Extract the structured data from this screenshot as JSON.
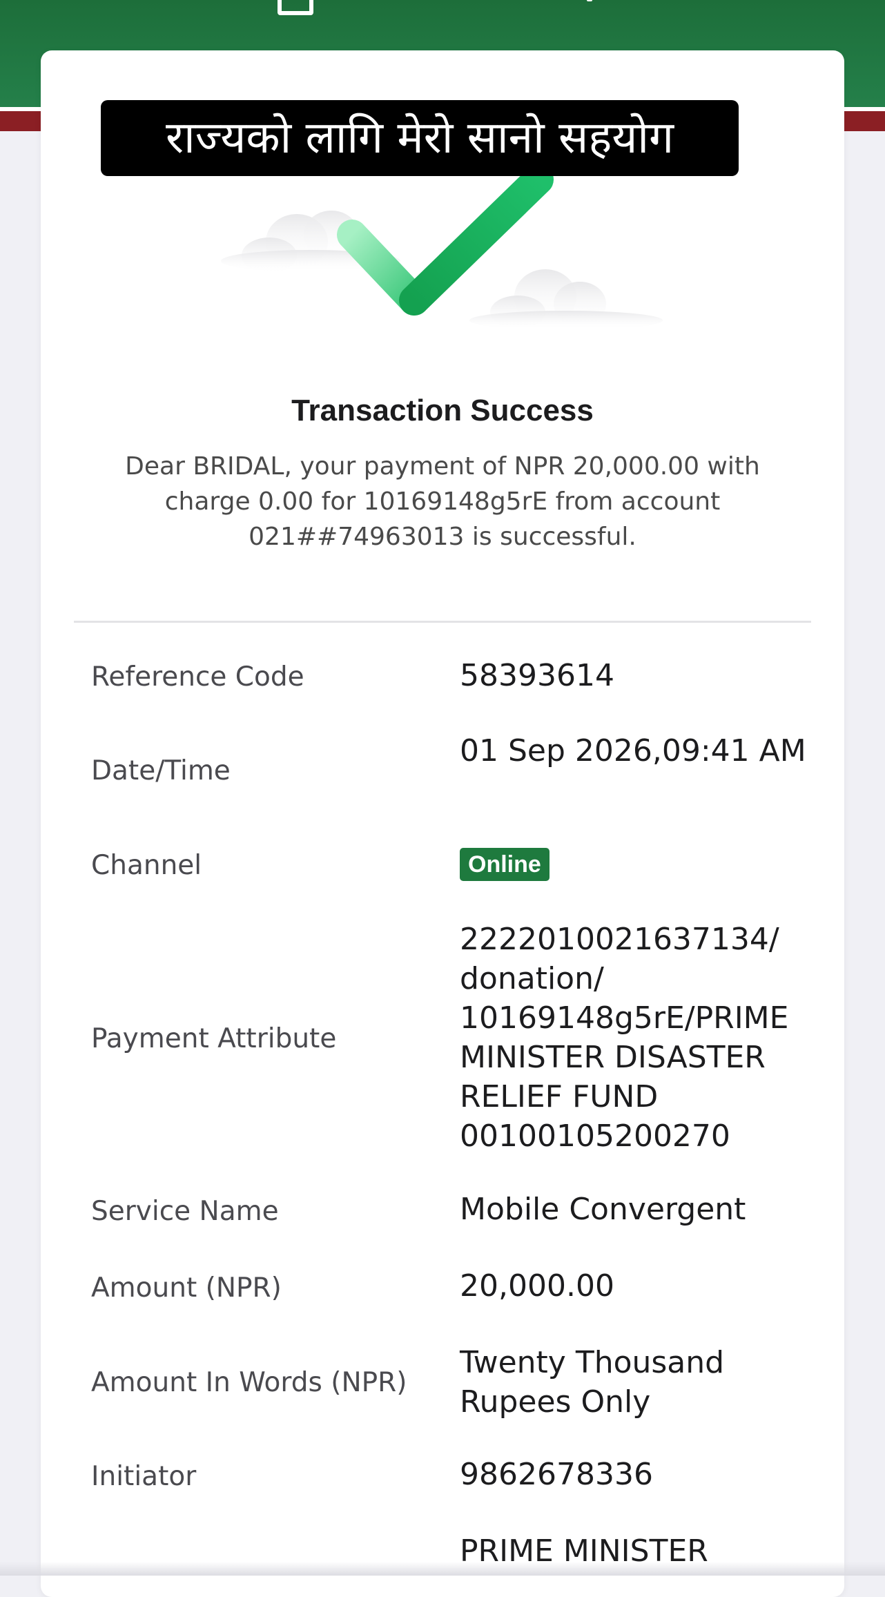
{
  "overlay": {
    "caption": "राज्यको लागि मेरो सानो सहयोग"
  },
  "status": {
    "title": "Transaction Success",
    "message": "Dear BRIDAL, your payment of NPR 20,000.00 with charge 0.00 for 10169148g5rE from account 021##74963013 is successful.",
    "icon": "checkmark-success-icon"
  },
  "details": [
    {
      "label": "Reference Code",
      "value": "58393614"
    },
    {
      "label": "Date/Time",
      "value": "01 Sep 2026,09:41 AM"
    },
    {
      "label": "Channel",
      "value": "Online"
    },
    {
      "label": "Payment Attribute",
      "value": "2222010021637134/ donation/ 10169148g5rE/PRIME MINISTER DISASTER RELIEF FUND 00100105200270"
    },
    {
      "label": "Service Name",
      "value": "Mobile Convergent"
    },
    {
      "label": "Amount (NPR)",
      "value": "20,000.00"
    },
    {
      "label": "Amount In Words (NPR)",
      "value": "Twenty Thousand Rupees Only"
    },
    {
      "label": "Initiator",
      "value": "9862678336"
    },
    {
      "label": "",
      "value": "PRIME MINISTER"
    }
  ],
  "colors": {
    "header_green": "#24804a",
    "accent_red": "#8b1f24",
    "success_green": "#1aa85a",
    "badge_green": "#1e7a3e"
  }
}
